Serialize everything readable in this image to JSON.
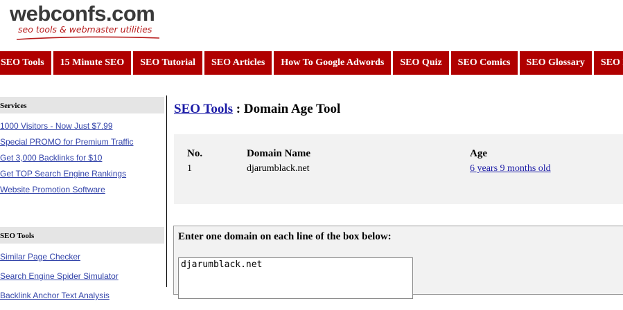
{
  "logo": {
    "main": "webconfs.com",
    "tagline": "seo tools & webmaster utilities"
  },
  "nav": {
    "items": [
      "SEO Tools",
      "15 Minute SEO",
      "SEO Tutorial",
      "SEO Articles",
      "How To Google Adwords",
      "SEO Quiz",
      "SEO Comics",
      "SEO Glossary",
      "SEO Puzzle"
    ]
  },
  "sidebar": {
    "services": {
      "heading": "Services",
      "links": [
        "1000 Visitors - Now Just $7.99",
        "Special PROMO for Premium Traffic",
        "Get 3,000 Backlinks for $10",
        "Get TOP Search Engine Rankings",
        "Website Promotion Software"
      ]
    },
    "tools": {
      "heading": "SEO Tools",
      "links": [
        "Similar Page Checker",
        "Search Engine Spider Simulator",
        "Backlink Anchor Text Analysis"
      ]
    }
  },
  "main": {
    "crumb_link": "SEO Tools",
    "crumb_sep": " : ",
    "page_title": "Domain Age Tool",
    "result": {
      "headers": {
        "no": "No.",
        "domain": "Domain Name",
        "age": "Age"
      },
      "rows": [
        {
          "no": "1",
          "domain": "djarumblack.net",
          "age": "6 years 9 months old"
        }
      ]
    },
    "form": {
      "label": "Enter one domain on each line of the box below:",
      "textarea_value": "djarumblack.net"
    }
  },
  "colors": {
    "nav_bg": "#b00000",
    "link": "#1a1aa6",
    "sidebar_link": "#3344aa",
    "panel_bg": "#f2f2f2"
  }
}
